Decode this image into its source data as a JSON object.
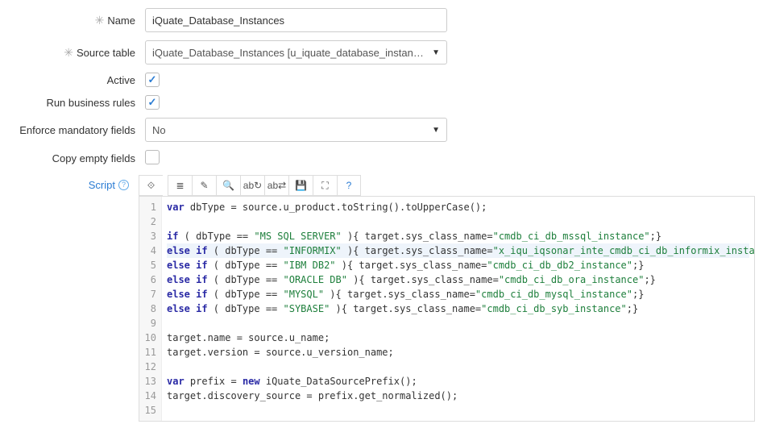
{
  "labels": {
    "name": "Name",
    "source_table": "Source table",
    "active": "Active",
    "run_business_rules": "Run business rules",
    "enforce_mandatory": "Enforce mandatory fields",
    "copy_empty": "Copy empty fields",
    "script": "Script"
  },
  "fields": {
    "name": "iQuate_Database_Instances",
    "source_table": "iQuate_Database_Instances [u_iquate_database_instances]",
    "active": true,
    "run_business_rules": true,
    "enforce_mandatory": "No",
    "copy_empty": false
  },
  "toolbar": {
    "toggle": "⟐",
    "format": "≣",
    "comment": "✎",
    "search": "🔍",
    "replace": "ab↻",
    "replace_all": "ab⇄",
    "save": "💾",
    "fullscreen": "⛶",
    "help": "?"
  },
  "code": {
    "lines": [
      {
        "n": 1,
        "segs": [
          {
            "t": "var ",
            "c": "kw"
          },
          {
            "t": "dbType = source.u_product.toString().toUpperCase();",
            "c": "ident"
          }
        ]
      },
      {
        "n": 2,
        "segs": []
      },
      {
        "n": 3,
        "segs": [
          {
            "t": "if",
            "c": "kw"
          },
          {
            "t": " ( dbType == ",
            "c": "ident"
          },
          {
            "t": "\"MS SQL SERVER\"",
            "c": "str"
          },
          {
            "t": " ){ target.sys_class_name=",
            "c": "ident"
          },
          {
            "t": "\"cmdb_ci_db_mssql_instance\"",
            "c": "str"
          },
          {
            "t": ";}",
            "c": "ident"
          }
        ]
      },
      {
        "n": 4,
        "hl": true,
        "segs": [
          {
            "t": "else if",
            "c": "kw"
          },
          {
            "t": " ( dbType == ",
            "c": "ident"
          },
          {
            "t": "\"INFORMIX\"",
            "c": "str"
          },
          {
            "t": " ){ target.sys_class_name=",
            "c": "ident"
          },
          {
            "t": "\"x_iqu_iqsonar_inte_cmdb_ci_db_informix_instance\"",
            "c": "str"
          },
          {
            "t": ";}",
            "c": "ident"
          }
        ]
      },
      {
        "n": 5,
        "segs": [
          {
            "t": "else if",
            "c": "kw"
          },
          {
            "t": " ( dbType == ",
            "c": "ident"
          },
          {
            "t": "\"IBM DB2\"",
            "c": "str"
          },
          {
            "t": " ){ target.sys_class_name=",
            "c": "ident"
          },
          {
            "t": "\"cmdb_ci_db_db2_instance\"",
            "c": "str"
          },
          {
            "t": ";}",
            "c": "ident"
          }
        ]
      },
      {
        "n": 6,
        "segs": [
          {
            "t": "else if",
            "c": "kw"
          },
          {
            "t": " ( dbType == ",
            "c": "ident"
          },
          {
            "t": "\"ORACLE DB\"",
            "c": "str"
          },
          {
            "t": " ){ target.sys_class_name=",
            "c": "ident"
          },
          {
            "t": "\"cmdb_ci_db_ora_instance\"",
            "c": "str"
          },
          {
            "t": ";}",
            "c": "ident"
          }
        ]
      },
      {
        "n": 7,
        "segs": [
          {
            "t": "else if",
            "c": "kw"
          },
          {
            "t": " ( dbType == ",
            "c": "ident"
          },
          {
            "t": "\"MYSQL\"",
            "c": "str"
          },
          {
            "t": " ){ target.sys_class_name=",
            "c": "ident"
          },
          {
            "t": "\"cmdb_ci_db_mysql_instance\"",
            "c": "str"
          },
          {
            "t": ";}",
            "c": "ident"
          }
        ]
      },
      {
        "n": 8,
        "segs": [
          {
            "t": "else if",
            "c": "kw"
          },
          {
            "t": " ( dbType == ",
            "c": "ident"
          },
          {
            "t": "\"SYBASE\"",
            "c": "str"
          },
          {
            "t": " ){ target.sys_class_name=",
            "c": "ident"
          },
          {
            "t": "\"cmdb_ci_db_syb_instance\"",
            "c": "str"
          },
          {
            "t": ";}",
            "c": "ident"
          }
        ]
      },
      {
        "n": 9,
        "segs": []
      },
      {
        "n": 10,
        "segs": [
          {
            "t": "target.name = source.u_name;",
            "c": "ident"
          }
        ]
      },
      {
        "n": 11,
        "segs": [
          {
            "t": "target.version = source.u_version_name;",
            "c": "ident"
          }
        ]
      },
      {
        "n": 12,
        "segs": []
      },
      {
        "n": 13,
        "segs": [
          {
            "t": "var ",
            "c": "kw"
          },
          {
            "t": "prefix = ",
            "c": "ident"
          },
          {
            "t": "new ",
            "c": "kw"
          },
          {
            "t": "iQuate_DataSourcePrefix();",
            "c": "ident"
          }
        ]
      },
      {
        "n": 14,
        "segs": [
          {
            "t": "target.discovery_source = prefix.get_normalized();",
            "c": "ident"
          }
        ]
      },
      {
        "n": 15,
        "segs": []
      }
    ]
  }
}
